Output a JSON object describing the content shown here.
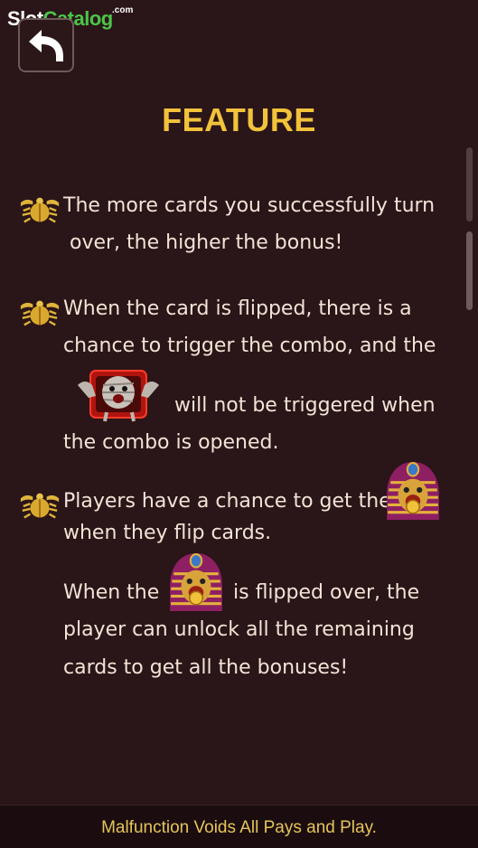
{
  "watermark": {
    "slot": "Slot",
    "catalog": "Catalog",
    "com": ".com"
  },
  "page": {
    "title": "FEATURE"
  },
  "features": {
    "f1_line1": "The more cards you successfully turn",
    "f1_line2": "over, the higher the bonus!",
    "f2_line1": "When the card is flipped, there is a",
    "f2_line2": "chance to trigger the combo, and the",
    "f2_line3": "will not be triggered when",
    "f2_line4": "the combo is opened.",
    "f3_line1": "Players have a chance to get the",
    "f3_line2": "when they flip cards.",
    "f3_line3a": "When the",
    "f3_line3b": "is flipped over, the",
    "f3_line4": "player can unlock all the remaining",
    "f3_line5": "cards to get all the bonuses!"
  },
  "icons": {
    "back": "back-arrow-icon",
    "bullet": "scarab-icon",
    "mummy": "mummy-icon",
    "pharaoh": "pharaoh-icon"
  },
  "footer": {
    "text": "Malfunction Voids All Pays and Play."
  },
  "colors": {
    "background": "#2a1518",
    "title": "#f2c23a",
    "text": "#f1e4d6",
    "footer_text": "#e4c55b",
    "watermark_green": "#4cc54a"
  }
}
